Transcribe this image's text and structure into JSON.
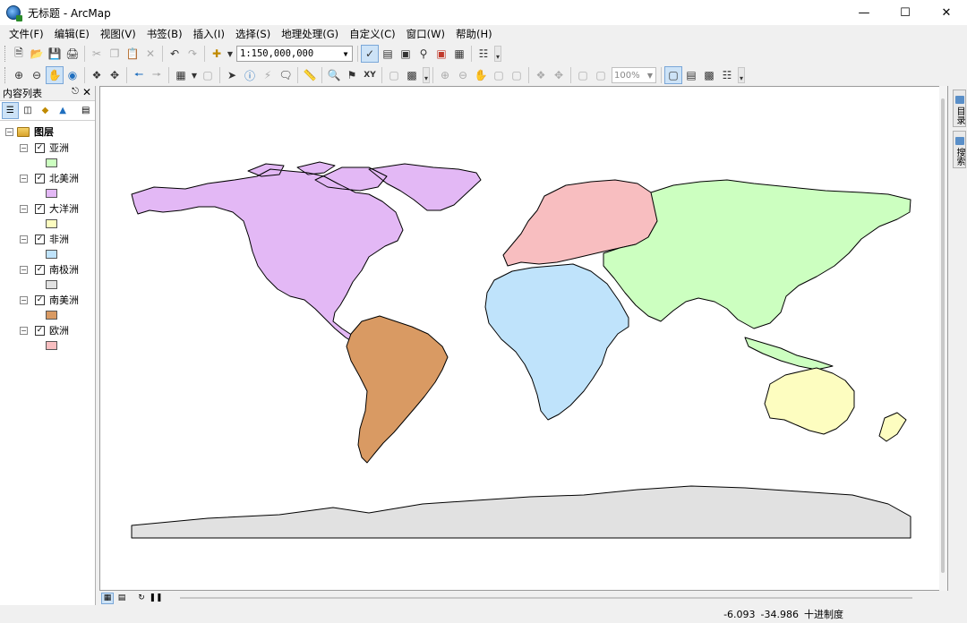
{
  "window": {
    "title": "无标题 - ArcMap"
  },
  "menu": [
    "文件(F)",
    "编辑(E)",
    "视图(V)",
    "书签(B)",
    "插入(I)",
    "选择(S)",
    "地理处理(G)",
    "自定义(C)",
    "窗口(W)",
    "帮助(H)"
  ],
  "toolbar": {
    "scale": "1:150,000,000",
    "zoom": "100%"
  },
  "toc": {
    "title": "内容列表",
    "group": "图层",
    "layers": [
      {
        "name": "亚洲",
        "color": "#ccffc0"
      },
      {
        "name": "北美洲",
        "color": "#e3b8f5"
      },
      {
        "name": "大洋洲",
        "color": "#fdfdc0"
      },
      {
        "name": "非洲",
        "color": "#bfe3fb"
      },
      {
        "name": "南极洲",
        "color": "#e1e1e1"
      },
      {
        "name": "南美洲",
        "color": "#d99a63"
      },
      {
        "name": "欧洲",
        "color": "#f8bec0"
      }
    ]
  },
  "dock": {
    "catalog": "目录",
    "search": "搜索"
  },
  "status": {
    "x": "-6.093",
    "y": "-34.986",
    "units": "十进制度"
  }
}
